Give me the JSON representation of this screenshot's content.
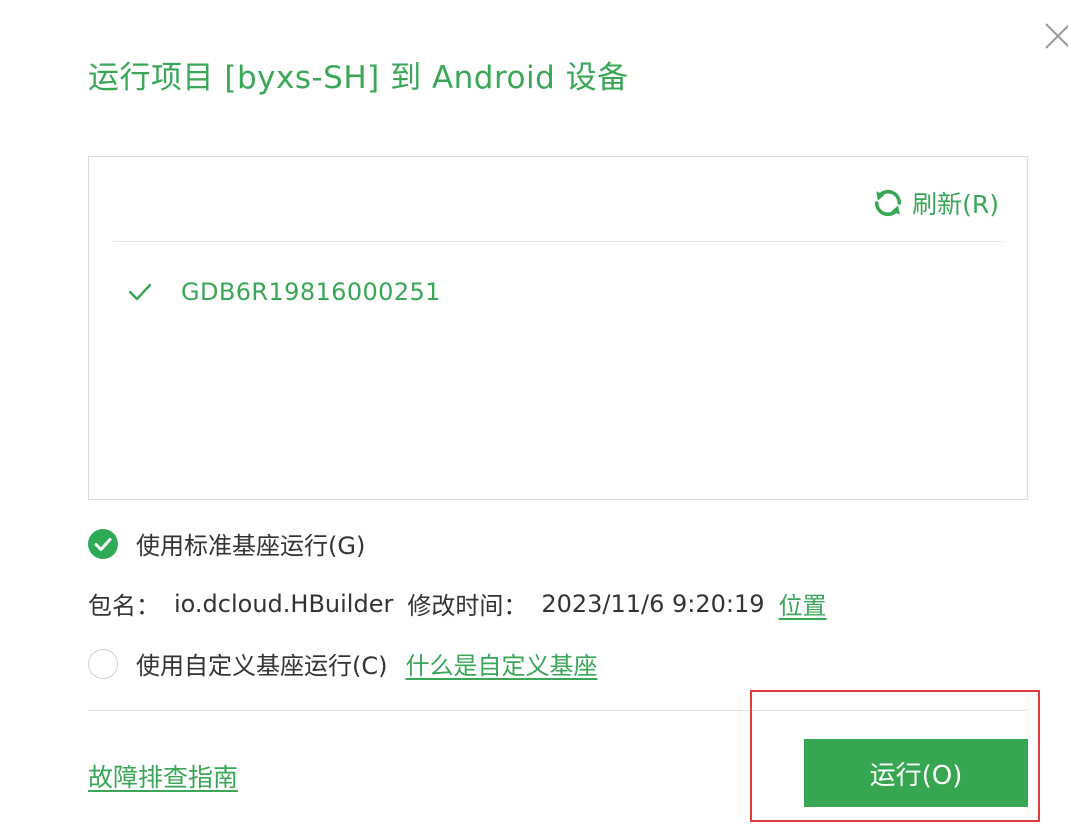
{
  "dialog": {
    "title": "运行项目 [byxs-SH] 到 Android 设备",
    "close_icon": "close-icon"
  },
  "device_panel": {
    "refresh_label": "刷新(R)",
    "refresh_icon": "refresh-icon",
    "devices": [
      {
        "name": "GDB6R19816000251",
        "selected": true
      }
    ]
  },
  "base_options": {
    "standard_label": "使用标准基座运行(G)",
    "standard_checked": true,
    "package_label": "包名：",
    "package_value": "io.dcloud.HBuilder",
    "modified_label": "修改时间：",
    "modified_value": "2023/11/6 9:20:19",
    "location_link": "位置",
    "custom_label": "使用自定义基座运行(C)",
    "custom_checked": false,
    "custom_help_link": "什么是自定义基座"
  },
  "footer": {
    "troubleshoot_link": "故障排查指南",
    "run_button": "运行(O)"
  },
  "colors": {
    "accent": "#3aa757",
    "button_bg": "#37a650",
    "highlight": "#e23a3a"
  }
}
